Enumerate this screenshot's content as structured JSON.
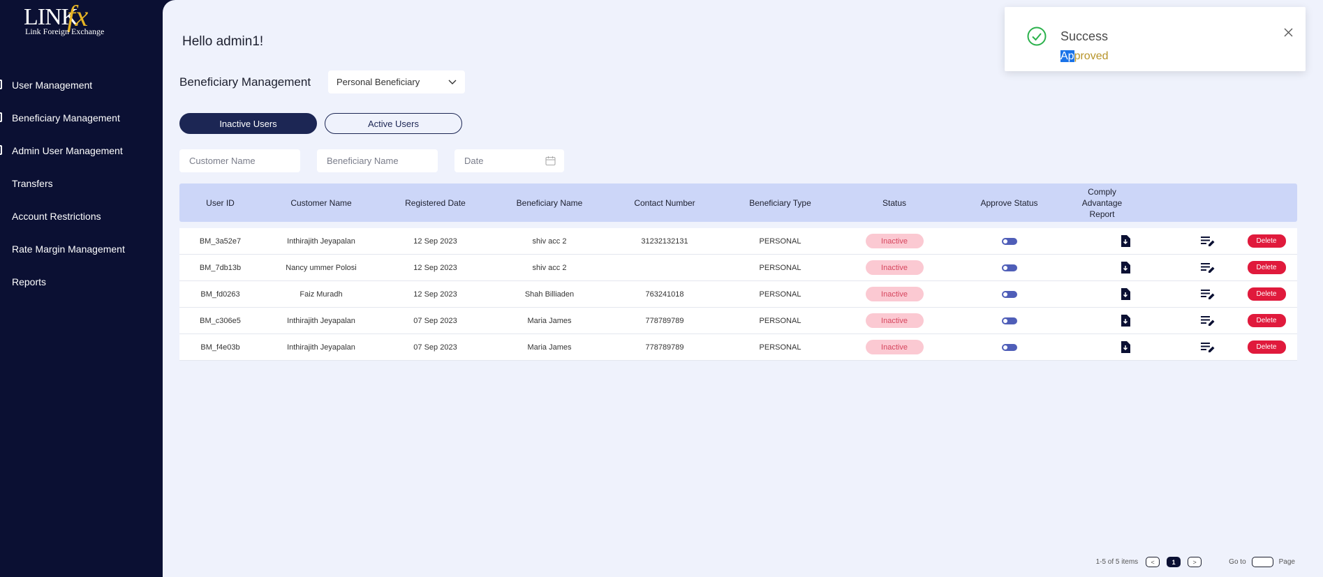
{
  "brand": {
    "logo_main": "LINK",
    "logo_accent": "fx",
    "tagline": "Link Foreign Exchange",
    "accent_color": "#e7b423"
  },
  "sidebar": {
    "items": [
      {
        "label": "User Management"
      },
      {
        "label": "Beneficiary Management"
      },
      {
        "label": "Admin User Management"
      },
      {
        "label": "Transfers"
      },
      {
        "label": "Account Restrictions"
      },
      {
        "label": "Rate Margin Management"
      },
      {
        "label": "Reports"
      }
    ]
  },
  "header": {
    "greeting": "Hello admin1!"
  },
  "section": {
    "title": "Beneficiary Management",
    "type_select": "Personal Beneficiary"
  },
  "tabs": [
    {
      "label": "Inactive Users",
      "active": true
    },
    {
      "label": "Active Users",
      "active": false
    }
  ],
  "filters": {
    "customer_placeholder": "Customer Name",
    "beneficiary_placeholder": "Beneficiary Name",
    "date_placeholder": "Date"
  },
  "table": {
    "columns": [
      "User ID",
      "Customer Name",
      "Registered Date",
      "Beneficiary Name",
      "Contact Number",
      "Beneficiary Type",
      "Status",
      "Approve Status",
      "Comply Advantage Report"
    ],
    "delete_label": "Delete",
    "rows": [
      {
        "user_id": "BM_3a52e7",
        "customer": "Inthirajith Jeyapalan",
        "date": "12 Sep 2023",
        "beneficiary": "shiv acc 2",
        "contact": "31232132131",
        "type": "PERSONAL",
        "status": "Inactive"
      },
      {
        "user_id": "BM_7db13b",
        "customer": "Nancy ummer Polosi",
        "date": "12 Sep 2023",
        "beneficiary": "shiv acc 2",
        "contact": "",
        "type": "PERSONAL",
        "status": "Inactive"
      },
      {
        "user_id": "BM_fd0263",
        "customer": "Faiz Muradh",
        "date": "12 Sep 2023",
        "beneficiary": "Shah Billiaden",
        "contact": "763241018",
        "type": "PERSONAL",
        "status": "Inactive"
      },
      {
        "user_id": "BM_c306e5",
        "customer": "Inthirajith Jeyapalan",
        "date": "07 Sep 2023",
        "beneficiary": "Maria James",
        "contact": "778789789",
        "type": "PERSONAL",
        "status": "Inactive"
      },
      {
        "user_id": "BM_f4e03b",
        "customer": "Inthirajith Jeyapalan",
        "date": "07 Sep 2023",
        "beneficiary": "Maria James",
        "contact": "778789789",
        "type": "PERSONAL",
        "status": "Inactive"
      }
    ]
  },
  "pagination": {
    "summary": "1-5 of 5 items",
    "prev": "<",
    "current": "1",
    "next": ">",
    "goto_label": "Go to",
    "page_label": "Page"
  },
  "toast": {
    "title": "Success",
    "message_highlight": "Ap",
    "message_rest": "proved"
  },
  "colors": {
    "sidebar_bg": "#0b1033",
    "main_bg": "#eff2fc",
    "header_row_bg": "#ccd6f8",
    "delete_red": "#e01a3c",
    "inactive_badge_bg": "#fbc9d2"
  }
}
